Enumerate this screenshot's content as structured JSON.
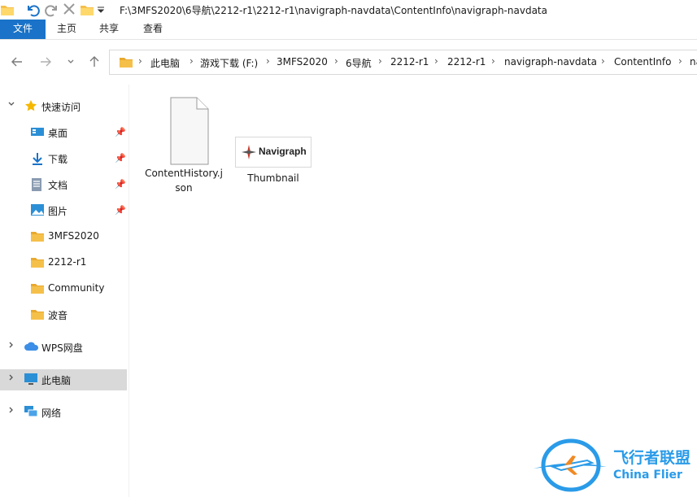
{
  "titlebar": {
    "path": "F:\\3MFS2020\\6导航\\2212-r1\\2212-r1\\navigraph-navdata\\ContentInfo\\navigraph-navdata"
  },
  "ribbon": {
    "tabs": [
      "文件",
      "主页",
      "共享",
      "查看"
    ]
  },
  "breadcrumb": [
    "此电脑",
    "游戏下载 (F:)",
    "3MFS2020",
    "6导航",
    "2212-r1",
    "2212-r1",
    "navigraph-navdata",
    "ContentInfo",
    "na"
  ],
  "sidebar": {
    "quick_access": "快速访问",
    "pinned": [
      {
        "label": "桌面",
        "icon": "desktop-icon"
      },
      {
        "label": "下载",
        "icon": "download-icon"
      },
      {
        "label": "文档",
        "icon": "document-icon"
      },
      {
        "label": "图片",
        "icon": "pictures-icon"
      }
    ],
    "folders": [
      "3MFS2020",
      "2212-r1",
      "Community",
      "波音"
    ],
    "wps": "WPS网盘",
    "this_pc": "此电脑",
    "network": "网络"
  },
  "files": [
    {
      "name_line1": "ContentHistory.j",
      "name_line2": "son",
      "icon": "json-file-icon"
    },
    {
      "name_line1": "Thumbnail",
      "name_line2": "",
      "icon": "image-thumbnail",
      "thumb_text": "Navigraph"
    }
  ],
  "watermark": {
    "cn": "飞行者联盟",
    "en": "China Flier"
  },
  "colors": {
    "accent": "#1a73c8",
    "selected": "#d9d9d9",
    "folder": "#f5c04a",
    "watermark": "#2a9be8"
  }
}
